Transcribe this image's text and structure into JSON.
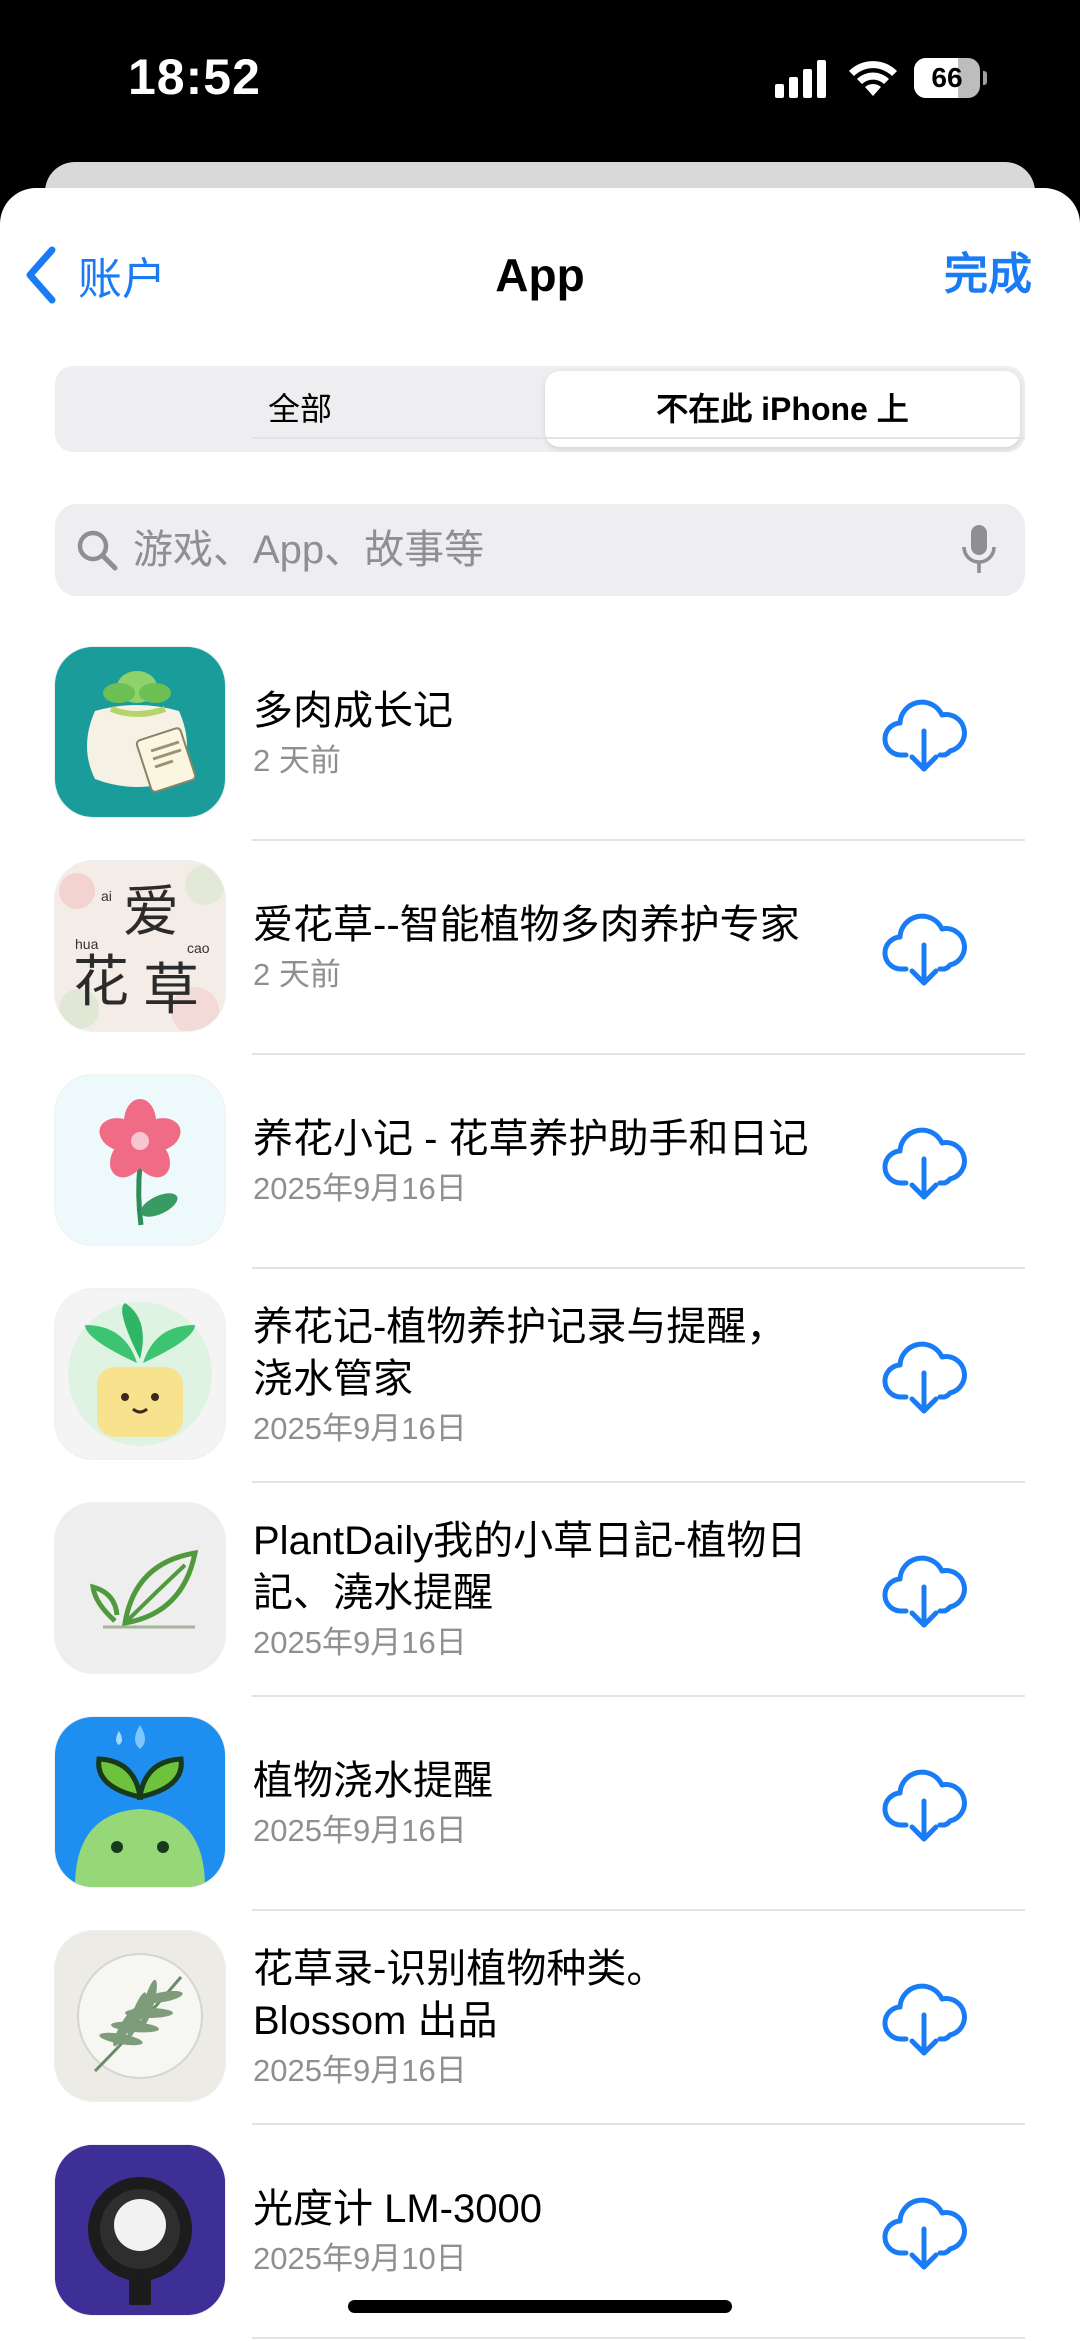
{
  "status_bar": {
    "time": "18:52",
    "battery": "66",
    "battery_level": 0.66
  },
  "nav": {
    "back_label": "账户",
    "title": "App",
    "done_label": "完成"
  },
  "segments": {
    "all": "全部",
    "not_on_device": "不在此 iPhone 上",
    "selected": "not_on_device"
  },
  "search": {
    "placeholder": "游戏、App、故事等"
  },
  "apps": [
    {
      "name": "多肉成长记",
      "date": "2 天前",
      "icon": "succulent-pot-icon"
    },
    {
      "name": "爱花草--智能植物多肉养护专家",
      "date": "2 天前",
      "icon": "aihuacao-icon"
    },
    {
      "name": "养花小记 - 花草养护助手和日记",
      "date": "2025年9月16日",
      "icon": "pink-flower-icon"
    },
    {
      "name": "养花记-植物养护记录与提醒，浇水管家",
      "date": "2025年9月16日",
      "icon": "plant-pot-face-icon"
    },
    {
      "name": "PlantDaily我的小草日記-植物日記、澆水提醒",
      "date": "2025年9月16日",
      "icon": "leaf-outline-icon"
    },
    {
      "name": "植物浇水提醒",
      "date": "2025年9月16日",
      "icon": "sprout-drop-icon"
    },
    {
      "name": "花草录-识别植物种类。Blossom 出品",
      "date": "2025年9月16日",
      "icon": "palm-leaf-icon"
    },
    {
      "name": "光度计 LM-3000",
      "date": "2025年9月10日",
      "icon": "light-meter-icon"
    }
  ],
  "icon_texts": {
    "ai": "爱",
    "hua": "花",
    "cao": "草",
    "ai_py": "ai",
    "hua_py": "hua",
    "cao_py": "cao"
  },
  "colors": {
    "accent": "#1a7cf5",
    "secondary_text": "#8e8e93"
  }
}
